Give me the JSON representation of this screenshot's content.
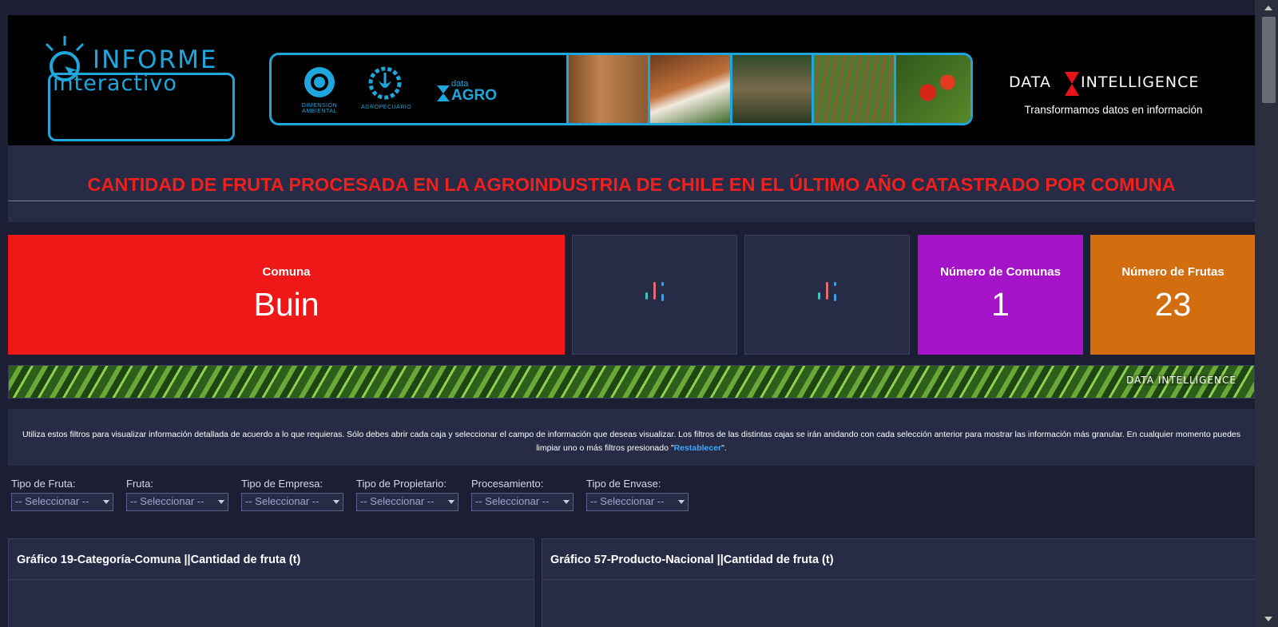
{
  "header": {
    "logo_word1": "INFORME",
    "logo_word2": "interactivo",
    "banner_logos": {
      "dimension": "DIMENSIÓN AMBIENTAL",
      "agro": "AGROPECUARIO",
      "data_small": "data",
      "data_big": "AGRO"
    },
    "brand_left": "DATA",
    "brand_right": "INTELLIGENCE",
    "tagline": "Transformamos datos en información"
  },
  "title": "CANTIDAD DE FRUTA PROCESADA EN LA AGROINDUSTRIA DE CHILE EN EL ÚLTIMO AÑO CATASTRADO POR COMUNA",
  "kpis": {
    "comuna_label": "Comuna",
    "comuna_value": "Buin",
    "comunas_label": "Número de Comunas",
    "comunas_value": "1",
    "frutas_label": "Número de Frutas",
    "frutas_value": "23"
  },
  "strip_brand": "DATA INTELLIGENCE",
  "instructions": {
    "text": "Utiliza estos filtros para visualizar información detallada de acuerdo a lo que requieras. Sólo debes abrir cada caja y seleccionar el campo de información que deseas visualizar. Los filtros de las distintas cajas se irán anidando con cada selección anterior para mostrar las información más granular. En cualquier momento puedes limpiar uno o más filtros presionado \"",
    "link": "Restablecer",
    "tail": "\"."
  },
  "filters": [
    {
      "label": "Tipo de Fruta:",
      "value": "-- Seleccionar --"
    },
    {
      "label": "Fruta:",
      "value": "-- Seleccionar --"
    },
    {
      "label": "Tipo de Empresa:",
      "value": "-- Seleccionar --"
    },
    {
      "label": "Tipo de Propietario:",
      "value": "-- Seleccionar --"
    },
    {
      "label": "Procesamiento:",
      "value": "-- Seleccionar --"
    },
    {
      "label": "Tipo de Envase:",
      "value": "-- Seleccionar --"
    }
  ],
  "panels": [
    {
      "title": "Gráfico 19-Categoría-Comuna ||Cantidad de fruta (t)"
    },
    {
      "title": "Gráfico 57-Producto-Nacional ||Cantidad de fruta (t)"
    }
  ],
  "colors": {
    "accent_blue": "#1fa6dc",
    "title_red": "#f0201c",
    "kpi_red": "#ef1818",
    "kpi_purple": "#a514c9",
    "kpi_orange": "#d26d10",
    "link_blue": "#3ea8ff"
  }
}
